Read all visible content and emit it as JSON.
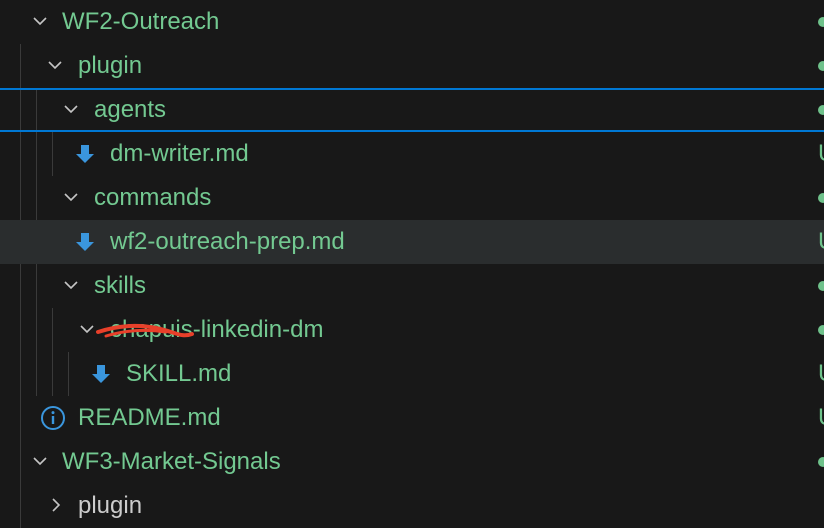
{
  "colors": {
    "folder_text": "#73c991",
    "file_text": "#73c991",
    "chevron": "#c5c5c5",
    "download_icon": "#3a96dd",
    "info_icon": "#3a96dd",
    "status_dot": "#6fc28b",
    "focus_border": "#0078d4",
    "annotation": "#e8402a"
  },
  "tree": {
    "items": [
      {
        "label": "WF2-Outreach",
        "kind": "folder",
        "expanded": true,
        "icon": "chevron-down-icon",
        "status": "dot"
      },
      {
        "label": "plugin",
        "kind": "folder",
        "expanded": true,
        "icon": "chevron-down-icon",
        "status": "dot"
      },
      {
        "label": "agents",
        "kind": "folder",
        "expanded": true,
        "icon": "chevron-down-icon",
        "status": "dot"
      },
      {
        "label": "dm-writer.md",
        "kind": "file",
        "icon": "download-arrow-icon",
        "status": "U"
      },
      {
        "label": "commands",
        "kind": "folder",
        "expanded": true,
        "icon": "chevron-down-icon",
        "status": "dot"
      },
      {
        "label": "wf2-outreach-prep.md",
        "kind": "file",
        "icon": "download-arrow-icon",
        "status": "U"
      },
      {
        "label": "skills",
        "kind": "folder",
        "expanded": true,
        "icon": "chevron-down-icon",
        "status": "dot"
      },
      {
        "label": "chapuis-linkedin-dm",
        "kind": "folder",
        "expanded": true,
        "icon": "chevron-down-icon",
        "status": "dot"
      },
      {
        "label": "SKILL.md",
        "kind": "file",
        "icon": "download-arrow-icon",
        "status": "U"
      },
      {
        "label": "README.md",
        "kind": "file",
        "icon": "info-icon",
        "status": "U"
      },
      {
        "label": "WF3-Market-Signals",
        "kind": "folder",
        "expanded": true,
        "icon": "chevron-down-icon",
        "status": "dot"
      },
      {
        "label": "plugin",
        "kind": "folder",
        "expanded": false,
        "icon": "chevron-right-icon",
        "status": "dot"
      }
    ]
  }
}
